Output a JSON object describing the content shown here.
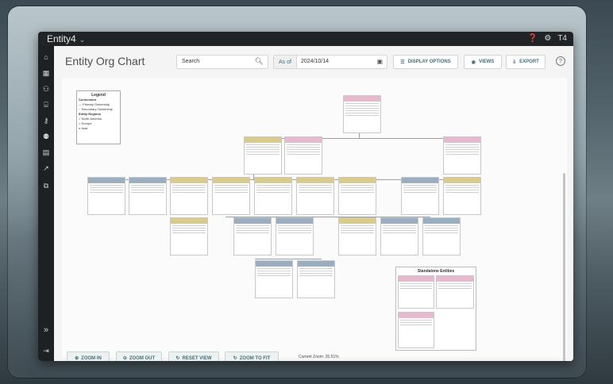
{
  "app": {
    "title": "Entity4",
    "user_initials": "T4"
  },
  "sidebar": {
    "items": [
      {
        "icon": "home-icon",
        "glyph": "⌂"
      },
      {
        "icon": "building-icon",
        "glyph": "▦"
      },
      {
        "icon": "org-icon",
        "glyph": "⚇"
      },
      {
        "icon": "bank-icon",
        "glyph": "⌸"
      },
      {
        "icon": "key-icon",
        "glyph": "⚷"
      },
      {
        "icon": "people-icon",
        "glyph": "⚉"
      },
      {
        "icon": "document-icon",
        "glyph": "▤"
      },
      {
        "icon": "analytics-icon",
        "glyph": "↗"
      },
      {
        "icon": "layers-icon",
        "glyph": "⧉"
      }
    ],
    "expand_glyph": "»",
    "logout_glyph": "⇥"
  },
  "header": {
    "page_title": "Entity Org Chart",
    "search_placeholder": "Search",
    "as_of_label": "As of",
    "as_of_value": "2024/10/14",
    "buttons": {
      "display_options": "DISPLAY OPTIONS",
      "views": "VIEWS",
      "export": "EXPORT"
    }
  },
  "legend": {
    "title": "Legend",
    "sections": [
      {
        "title": "Connectors",
        "items": [
          "Primary Ownership",
          "Secondary Ownership"
        ]
      },
      {
        "title": "Entity Regions",
        "items": [
          "North America",
          "Europe",
          "Asia"
        ]
      }
    ]
  },
  "standalone": {
    "title": "Standalone Entities"
  },
  "zoom": {
    "zoom_in": "ZOOM IN",
    "zoom_out": "ZOOM OUT",
    "reset_view": "RESET VIEW",
    "zoom_to_fit": "ZOOM TO FIT",
    "current_zoom": "Current Zoom: 26.51%"
  },
  "colors": {
    "region_north_america": "#e7b9cf",
    "region_europe": "#d9cb8c",
    "region_asia": "#9aaec0",
    "accent": "#3d6f78"
  }
}
